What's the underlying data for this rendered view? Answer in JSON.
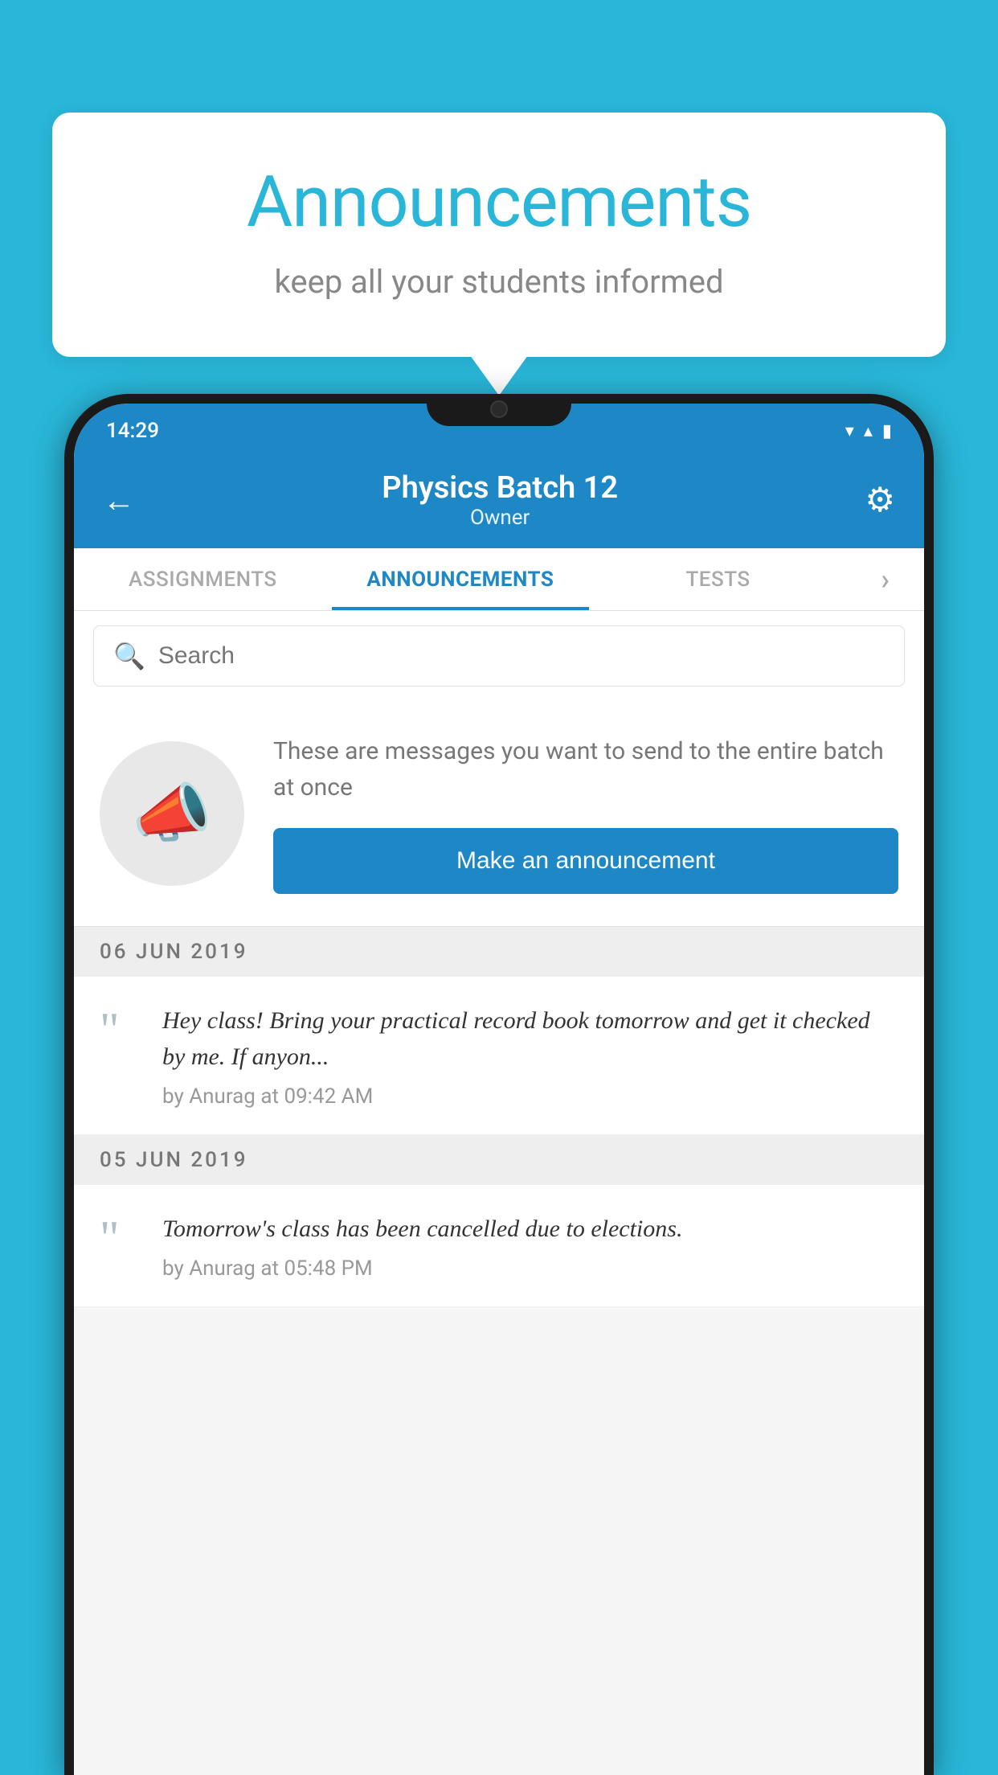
{
  "background_color": "#29b6d8",
  "speech_bubble": {
    "title": "Announcements",
    "subtitle": "keep all your students informed"
  },
  "phone": {
    "status_bar": {
      "time": "14:29",
      "wifi": "▼",
      "signal": "▲",
      "battery": "▌"
    },
    "header": {
      "back_label": "←",
      "title": "Physics Batch 12",
      "subtitle": "Owner",
      "gear_label": "⚙"
    },
    "tabs": [
      {
        "label": "ASSIGNMENTS",
        "active": false
      },
      {
        "label": "ANNOUNCEMENTS",
        "active": true
      },
      {
        "label": "TESTS",
        "active": false
      },
      {
        "label": "›",
        "active": false
      }
    ],
    "search": {
      "placeholder": "Search"
    },
    "promo": {
      "description": "These are messages you want to send to the entire batch at once",
      "button_label": "Make an announcement"
    },
    "announcements": [
      {
        "date": "06  JUN  2019",
        "text": "Hey class! Bring your practical record book tomorrow and get it checked by me. If anyon...",
        "meta": "by Anurag at 09:42 AM"
      },
      {
        "date": "05  JUN  2019",
        "text": "Tomorrow's class has been cancelled due to elections.",
        "meta": "by Anurag at 05:48 PM"
      }
    ]
  }
}
